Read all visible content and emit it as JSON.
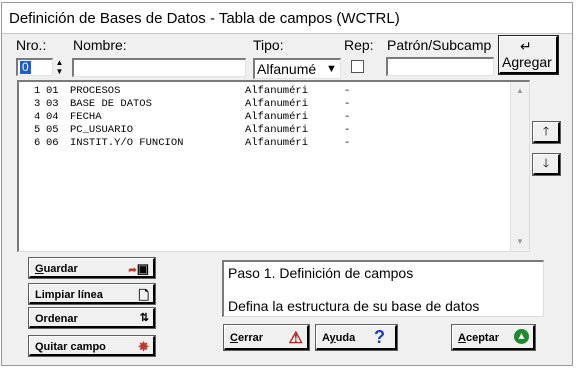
{
  "window": {
    "title": "Definición de Bases de Datos - Tabla de campos (WCTRL)"
  },
  "form": {
    "nro_label": "Nro.:",
    "nro_value": "0",
    "nombre_label": "Nombre:",
    "nombre_value": "",
    "tipo_label": "Tipo:",
    "tipo_value": "Alfanumé",
    "rep_label": "Rep:",
    "patron_label": "Patrón/Subcamp",
    "patron_value": ""
  },
  "agregar": {
    "icon": "return-arrow-icon",
    "label": "Agregar"
  },
  "table": {
    "rows": [
      {
        "num": "1",
        "code": "01",
        "name": "PROCESOS",
        "type": "Alfanuméri",
        "pattern": "-"
      },
      {
        "num": "3",
        "code": "03",
        "name": "BASE DE DATOS",
        "type": "Alfanuméri",
        "pattern": "-"
      },
      {
        "num": "4",
        "code": "04",
        "name": "FECHA",
        "type": "Alfanuméri",
        "pattern": "-"
      },
      {
        "num": "5",
        "code": "05",
        "name": "PC_USUARIO",
        "type": "Alfanuméri",
        "pattern": "-"
      },
      {
        "num": "6",
        "code": "06",
        "name": "INSTIT.Y/O FUNCION",
        "type": "Alfanuméri",
        "pattern": "-"
      }
    ]
  },
  "side_buttons": {
    "up_icon": "arrow-up-icon",
    "down_icon": "arrow-down-icon"
  },
  "buttons": {
    "guardar": {
      "label": "Guardar",
      "icon": "save-icon"
    },
    "limpiar": {
      "label": "Limpiar línea",
      "icon": "blank-page-icon"
    },
    "ordenar": {
      "label": "Ordenar",
      "icon": "sort-icon"
    },
    "quitar": {
      "label": "Quitar campo",
      "icon": "delete-icon"
    },
    "cerrar": {
      "label": "Cerrar",
      "icon": "warning-icon"
    },
    "ayuda": {
      "label": "Ayuda",
      "icon": "help-icon"
    },
    "aceptar": {
      "label": "Aceptar",
      "icon": "accept-arrow-icon"
    }
  },
  "status": {
    "line1": "Paso 1. Definición de campos",
    "line2": "Defina la estructura de su base de datos"
  },
  "colors": {
    "window_bg": "#f0f0f0",
    "selection": "#1b5fd0",
    "save_icon": "#c0392b",
    "warning_icon": "#b22222",
    "help_icon": "#1a3fb8",
    "accept_icon": "#1e8a2e"
  }
}
